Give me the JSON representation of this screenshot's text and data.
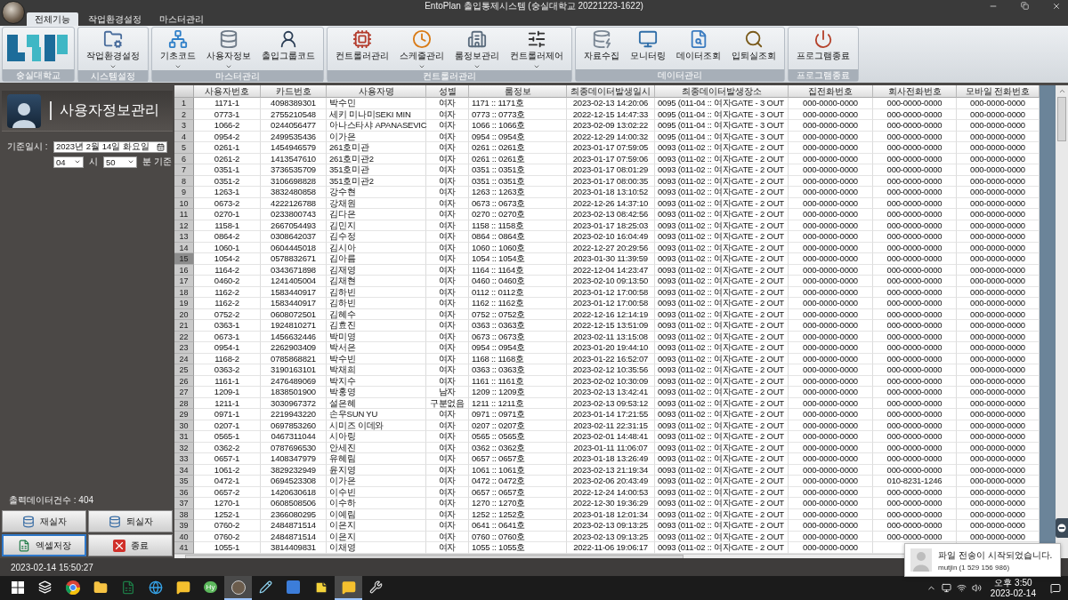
{
  "window": {
    "title": "EntoPlan 출입통제시스템 (숭실대학교 20221223-1622)"
  },
  "tabs": [
    {
      "label": "전체기능",
      "selected": true
    },
    {
      "label": "작업환경설정",
      "selected": false
    },
    {
      "label": "마스터관리",
      "selected": false
    }
  ],
  "ribbon": {
    "groups": [
      {
        "kind": "logo",
        "label": "숭실대학교"
      },
      {
        "kind": "buttons",
        "label": "시스템설정",
        "buttons": [
          {
            "label": "작업환경설정",
            "dropdown": true
          }
        ]
      },
      {
        "kind": "buttons",
        "label": "마스터관리",
        "buttons": [
          {
            "label": "기초코드",
            "dropdown": true
          },
          {
            "label": "사용자정보",
            "dropdown": true
          },
          {
            "label": "출입그룹코드",
            "dropdown": false
          }
        ]
      },
      {
        "kind": "buttons",
        "label": "컨트롤러관리",
        "buttons": [
          {
            "label": "컨트롤러관리",
            "dropdown": false
          },
          {
            "label": "스케줄관리",
            "dropdown": true
          },
          {
            "label": "룸정보관리",
            "dropdown": true
          },
          {
            "label": "컨트롤러제어",
            "dropdown": true
          }
        ]
      },
      {
        "kind": "buttons",
        "label": "데이터관리",
        "buttons": [
          {
            "label": "자료수집",
            "dropdown": false
          },
          {
            "label": "모니터링",
            "dropdown": false
          },
          {
            "label": "데이터조회",
            "dropdown": false
          },
          {
            "label": "입퇴실조회",
            "dropdown": false
          }
        ]
      },
      {
        "kind": "buttons",
        "label": "프로그램종료",
        "buttons": [
          {
            "label": "프로그램종료",
            "dropdown": false
          }
        ]
      }
    ]
  },
  "panel": {
    "title": "사용자정보관리",
    "date_label": "기준일시 :",
    "date_value": "2023년  2월 14일 화요일",
    "hour_value": "04",
    "hour_unit": "시",
    "minute_value": "50",
    "minute_unit": "분 기준",
    "count_label": "출력데이터건수 :  404",
    "buttons": [
      {
        "label": "재실자",
        "selected": false
      },
      {
        "label": "퇴실자",
        "selected": false
      },
      {
        "label": "엑셀저장",
        "selected": true
      },
      {
        "label": "종료",
        "selected": false
      }
    ]
  },
  "table": {
    "columns": [
      "사용자번호",
      "카드번호",
      "사용자명",
      "성별",
      "룸정보",
      "최종데이터발생일시",
      "최종데이터발생장소",
      "집전화번호",
      "회사전화번호",
      "모바일 전화번호"
    ],
    "rows": [
      {
        "number": "1",
        "selected": false,
        "cells": [
          "1171-1",
          "4098389301",
          "박수민",
          "여자",
          "1171 :: 1171호",
          "2023-02-13 14:20:06",
          "0095 (011-04 :: 여자GATE - 3 OUT",
          "000-0000-0000",
          "000-0000-0000",
          "000-0000-0000"
        ]
      },
      {
        "number": "2",
        "selected": false,
        "cells": [
          "0773-1",
          "2755210548",
          "세키 미나미SEKI MIN",
          "여자",
          "0773 :: 0773호",
          "2022-12-15 14:47:33",
          "0095 (011-04 :: 여자GATE - 3 OUT",
          "000-0000-0000",
          "000-0000-0000",
          "000-0000-0000"
        ]
      },
      {
        "number": "3",
        "selected": false,
        "cells": [
          "1066-2",
          "0244056477",
          "아나스타샤 APANASEVIC",
          "여자",
          "1066 :: 1066호",
          "2023-02-09 13:02:22",
          "0095 (011-04 :: 여자GATE - 3 OUT",
          "000-0000-0000",
          "000-0000-0000",
          "000-0000-0000"
        ]
      },
      {
        "number": "4",
        "selected": false,
        "cells": [
          "0954-2",
          "2499535436",
          "이가은",
          "여자",
          "0954 :: 0954호",
          "2022-12-29 14:00:32",
          "0095 (011-04 :: 여자GATE - 3 OUT",
          "000-0000-0000",
          "000-0000-0000",
          "000-0000-0000"
        ]
      },
      {
        "number": "5",
        "selected": false,
        "cells": [
          "0261-1",
          "1454946579",
          "261호미관",
          "여자",
          "0261 :: 0261호",
          "2023-01-17 07:59:05",
          "0093 (011-02 :: 여자GATE - 2 OUT",
          "000-0000-0000",
          "000-0000-0000",
          "000-0000-0000"
        ]
      },
      {
        "number": "6",
        "selected": false,
        "cells": [
          "0261-2",
          "1413547610",
          "261호미관2",
          "여자",
          "0261 :: 0261호",
          "2023-01-17 07:59:06",
          "0093 (011-02 :: 여자GATE - 2 OUT",
          "000-0000-0000",
          "000-0000-0000",
          "000-0000-0000"
        ]
      },
      {
        "number": "7",
        "selected": false,
        "cells": [
          "0351-1",
          "3736535709",
          "351호미관",
          "여자",
          "0351 :: 0351호",
          "2023-01-17 08:01:29",
          "0093 (011-02 :: 여자GATE - 2 OUT",
          "000-0000-0000",
          "000-0000-0000",
          "000-0000-0000"
        ]
      },
      {
        "number": "8",
        "selected": false,
        "cells": [
          "0351-2",
          "3106698828",
          "351호미관2",
          "여자",
          "0351 :: 0351호",
          "2023-01-17 08:00:35",
          "0093 (011-02 :: 여자GATE - 2 OUT",
          "000-0000-0000",
          "000-0000-0000",
          "000-0000-0000"
        ]
      },
      {
        "number": "9",
        "selected": false,
        "cells": [
          "1263-1",
          "3832480858",
          "강수현",
          "여자",
          "1263 :: 1263호",
          "2023-01-18 13:10:52",
          "0093 (011-02 :: 여자GATE - 2 OUT",
          "000-0000-0000",
          "000-0000-0000",
          "000-0000-0000"
        ]
      },
      {
        "number": "10",
        "selected": false,
        "cells": [
          "0673-2",
          "4222126788",
          "강채원",
          "여자",
          "0673 :: 0673호",
          "2022-12-26 14:37:10",
          "0093 (011-02 :: 여자GATE - 2 OUT",
          "000-0000-0000",
          "000-0000-0000",
          "000-0000-0000"
        ]
      },
      {
        "number": "11",
        "selected": false,
        "cells": [
          "0270-1",
          "0233800743",
          "김다은",
          "여자",
          "0270 :: 0270호",
          "2023-02-13 08:42:56",
          "0093 (011-02 :: 여자GATE - 2 OUT",
          "000-0000-0000",
          "000-0000-0000",
          "000-0000-0000"
        ]
      },
      {
        "number": "12",
        "selected": false,
        "cells": [
          "1158-1",
          "2667054493",
          "김민지",
          "여자",
          "1158 :: 1158호",
          "2023-01-17 18:25:03",
          "0093 (011-02 :: 여자GATE - 2 OUT",
          "000-0000-0000",
          "000-0000-0000",
          "000-0000-0000"
        ]
      },
      {
        "number": "13",
        "selected": false,
        "cells": [
          "0864-2",
          "0308642037",
          "김수정",
          "여자",
          "0864 :: 0864호",
          "2023-02-10 16:04:49",
          "0093 (011-02 :: 여자GATE - 2 OUT",
          "000-0000-0000",
          "000-0000-0000",
          "000-0000-0000"
        ]
      },
      {
        "number": "14",
        "selected": false,
        "cells": [
          "1060-1",
          "0604445018",
          "김시아",
          "여자",
          "1060 :: 1060호",
          "2022-12-27 20:29:56",
          "0093 (011-02 :: 여자GATE - 2 OUT",
          "000-0000-0000",
          "000-0000-0000",
          "000-0000-0000"
        ]
      },
      {
        "number": "15",
        "selected": true,
        "cells": [
          "1054-2",
          "0578832671",
          "김아름",
          "여자",
          "1054 :: 1054호",
          "2023-01-30 11:39:59",
          "0093 (011-02 :: 여자GATE - 2 OUT",
          "000-0000-0000",
          "000-0000-0000",
          "000-0000-0000"
        ]
      },
      {
        "number": "16",
        "selected": false,
        "cells": [
          "1164-2",
          "0343671898",
          "김재영",
          "여자",
          "1164 :: 1164호",
          "2022-12-04 14:23:47",
          "0093 (011-02 :: 여자GATE - 2 OUT",
          "000-0000-0000",
          "000-0000-0000",
          "000-0000-0000"
        ]
      },
      {
        "number": "17",
        "selected": false,
        "cells": [
          "0460-2",
          "1241405004",
          "김채현",
          "여자",
          "0460 :: 0460호",
          "2023-02-10 09:13:50",
          "0093 (011-02 :: 여자GATE - 2 OUT",
          "000-0000-0000",
          "000-0000-0000",
          "000-0000-0000"
        ]
      },
      {
        "number": "18",
        "selected": false,
        "cells": [
          "1162-2",
          "1583440917",
          "김하빈",
          "여자",
          "0112 :: 0112호",
          "2023-01-12 17:00:58",
          "0093 (011-02 :: 여자GATE - 2 OUT",
          "000-0000-0000",
          "000-0000-0000",
          "000-0000-0000"
        ]
      },
      {
        "number": "19",
        "selected": false,
        "cells": [
          "1162-2",
          "1583440917",
          "김하빈",
          "여자",
          "1162 :: 1162호",
          "2023-01-12 17:00:58",
          "0093 (011-02 :: 여자GATE - 2 OUT",
          "000-0000-0000",
          "000-0000-0000",
          "000-0000-0000"
        ]
      },
      {
        "number": "20",
        "selected": false,
        "cells": [
          "0752-2",
          "0608072501",
          "김혜수",
          "여자",
          "0752 :: 0752호",
          "2022-12-16 12:14:19",
          "0093 (011-02 :: 여자GATE - 2 OUT",
          "000-0000-0000",
          "000-0000-0000",
          "000-0000-0000"
        ]
      },
      {
        "number": "21",
        "selected": false,
        "cells": [
          "0363-1",
          "1924810271",
          "김효진",
          "여자",
          "0363 :: 0363호",
          "2022-12-15 13:51:09",
          "0093 (011-02 :: 여자GATE - 2 OUT",
          "000-0000-0000",
          "000-0000-0000",
          "000-0000-0000"
        ]
      },
      {
        "number": "22",
        "selected": false,
        "cells": [
          "0673-1",
          "1456632446",
          "박미영",
          "여자",
          "0673 :: 0673호",
          "2023-02-11 13:15:08",
          "0093 (011-02 :: 여자GATE - 2 OUT",
          "000-0000-0000",
          "000-0000-0000",
          "000-0000-0000"
        ]
      },
      {
        "number": "23",
        "selected": false,
        "cells": [
          "0954-1",
          "2262903409",
          "박서은",
          "여자",
          "0954 :: 0954호",
          "2023-01-20 19:44:10",
          "0093 (011-02 :: 여자GATE - 2 OUT",
          "000-0000-0000",
          "000-0000-0000",
          "000-0000-0000"
        ]
      },
      {
        "number": "24",
        "selected": false,
        "cells": [
          "1168-2",
          "0785868821",
          "박수빈",
          "여자",
          "1168 :: 1168호",
          "2023-01-22 16:52:07",
          "0093 (011-02 :: 여자GATE - 2 OUT",
          "000-0000-0000",
          "000-0000-0000",
          "000-0000-0000"
        ]
      },
      {
        "number": "25",
        "selected": false,
        "cells": [
          "0363-2",
          "3190163101",
          "박채희",
          "여자",
          "0363 :: 0363호",
          "2023-02-12 10:35:56",
          "0093 (011-02 :: 여자GATE - 2 OUT",
          "000-0000-0000",
          "000-0000-0000",
          "000-0000-0000"
        ]
      },
      {
        "number": "26",
        "selected": false,
        "cells": [
          "1161-1",
          "2476489069",
          "박지수",
          "여자",
          "1161 :: 1161호",
          "2023-02-02 10:30:09",
          "0093 (011-02 :: 여자GATE - 2 OUT",
          "000-0000-0000",
          "000-0000-0000",
          "000-0000-0000"
        ]
      },
      {
        "number": "27",
        "selected": false,
        "cells": [
          "1209-1",
          "1838501900",
          "박홍영",
          "남자",
          "1209 :: 1209호",
          "2023-02-13 13:42:41",
          "0093 (011-02 :: 여자GATE - 2 OUT",
          "000-0000-0000",
          "000-0000-0000",
          "000-0000-0000"
        ]
      },
      {
        "number": "28",
        "selected": false,
        "cells": [
          "1211-1",
          "3030967372",
          "설은혜",
          "구분없음",
          "1211 :: 1211호",
          "2023-02-13 09:53:12",
          "0093 (011-02 :: 여자GATE - 2 OUT",
          "000-0000-0000",
          "000-0000-0000",
          "000-0000-0000"
        ]
      },
      {
        "number": "29",
        "selected": false,
        "cells": [
          "0971-1",
          "2219943220",
          "손우SUN YU",
          "여자",
          "0971 :: 0971호",
          "2023-01-14 17:21:55",
          "0093 (011-02 :: 여자GATE - 2 OUT",
          "000-0000-0000",
          "000-0000-0000",
          "000-0000-0000"
        ]
      },
      {
        "number": "30",
        "selected": false,
        "cells": [
          "0207-1",
          "0697853260",
          "시미즈 이데와",
          "여자",
          "0207 :: 0207호",
          "2023-02-11 22:31:15",
          "0093 (011-02 :: 여자GATE - 2 OUT",
          "000-0000-0000",
          "000-0000-0000",
          "000-0000-0000"
        ]
      },
      {
        "number": "31",
        "selected": false,
        "cells": [
          "0565-1",
          "0467311044",
          "시아링",
          "여자",
          "0565 :: 0565호",
          "2023-02-01 14:48:41",
          "0093 (011-02 :: 여자GATE - 2 OUT",
          "000-0000-0000",
          "000-0000-0000",
          "000-0000-0000"
        ]
      },
      {
        "number": "32",
        "selected": false,
        "cells": [
          "0362-2",
          "0787696530",
          "안세진",
          "여자",
          "0362 :: 0362호",
          "2023-01-11 11:06:07",
          "0093 (011-02 :: 여자GATE - 2 OUT",
          "000-0000-0000",
          "000-0000-0000",
          "000-0000-0000"
        ]
      },
      {
        "number": "33",
        "selected": false,
        "cells": [
          "0657-1",
          "1408347979",
          "유혜림",
          "여자",
          "0657 :: 0657호",
          "2023-01-18 13:26:49",
          "0093 (011-02 :: 여자GATE - 2 OUT",
          "000-0000-0000",
          "000-0000-0000",
          "000-0000-0000"
        ]
      },
      {
        "number": "34",
        "selected": false,
        "cells": [
          "1061-2",
          "3829232949",
          "윤지영",
          "여자",
          "1061 :: 1061호",
          "2023-02-13 21:19:34",
          "0093 (011-02 :: 여자GATE - 2 OUT",
          "000-0000-0000",
          "000-0000-0000",
          "000-0000-0000"
        ]
      },
      {
        "number": "35",
        "selected": false,
        "cells": [
          "0472-1",
          "0694523308",
          "이가은",
          "여자",
          "0472 :: 0472호",
          "2023-02-06 20:43:49",
          "0093 (011-02 :: 여자GATE - 2 OUT",
          "000-0000-0000",
          "010-8231-1246",
          "000-0000-0000"
        ]
      },
      {
        "number": "36",
        "selected": false,
        "cells": [
          "0657-2",
          "1420630618",
          "이수빈",
          "여자",
          "0657 :: 0657호",
          "2022-12-24 14:00:53",
          "0093 (011-02 :: 여자GATE - 2 OUT",
          "000-0000-0000",
          "000-0000-0000",
          "000-0000-0000"
        ]
      },
      {
        "number": "37",
        "selected": false,
        "cells": [
          "1270-1",
          "0608508506",
          "이수하",
          "여자",
          "1270 :: 1270호",
          "2022-12-30 19:36:29",
          "0093 (011-02 :: 여자GATE - 2 OUT",
          "000-0000-0000",
          "000-0000-0000",
          "000-0000-0000"
        ]
      },
      {
        "number": "38",
        "selected": false,
        "cells": [
          "1252-1",
          "2366080295",
          "이예림",
          "여자",
          "1252 :: 1252호",
          "2023-01-18 12:01:34",
          "0093 (011-02 :: 여자GATE - 2 OUT",
          "000-0000-0000",
          "000-0000-0000",
          "000-0000-0000"
        ]
      },
      {
        "number": "39",
        "selected": false,
        "cells": [
          "0760-2",
          "2484871514",
          "이은지",
          "여자",
          "0641 :: 0641호",
          "2023-02-13 09:13:25",
          "0093 (011-02 :: 여자GATE - 2 OUT",
          "000-0000-0000",
          "000-0000-0000",
          "000-0000-0000"
        ]
      },
      {
        "number": "40",
        "selected": false,
        "cells": [
          "0760-2",
          "2484871514",
          "이은지",
          "여자",
          "0760 :: 0760호",
          "2023-02-13 09:13:25",
          "0093 (011-02 :: 여자GATE - 2 OUT",
          "000-0000-0000",
          "000-0000-0000",
          "000-0000-0000"
        ]
      },
      {
        "number": "41",
        "selected": false,
        "cells": [
          "1055-1",
          "3814409831",
          "이채영",
          "여자",
          "1055 :: 1055호",
          "2022-11-06 19:06:17",
          "0093 (011-02 :: 여자GATE - 2 OUT",
          "000-0000-0000"
        ]
      }
    ]
  },
  "status_bar": {
    "timestamp": "2023-02-14 15:50:27"
  },
  "notification": {
    "message": "파일 전송이 시작되었습니다.",
    "sender": "mutjin (1 529 156 986)"
  },
  "taskbar": {
    "apps": [
      {
        "selected": false
      },
      {
        "selected": false
      },
      {
        "selected": false
      },
      {
        "selected": false
      },
      {
        "selected": false
      },
      {
        "selected": false
      },
      {
        "selected": false
      },
      {
        "selected": false,
        "label": "Hy"
      },
      {
        "selected": true
      },
      {
        "selected": false
      },
      {
        "selected": false
      },
      {
        "selected": false
      },
      {
        "selected": true
      },
      {
        "selected": false
      }
    ],
    "time": "오후 3:50",
    "date": "2023-02-14"
  }
}
